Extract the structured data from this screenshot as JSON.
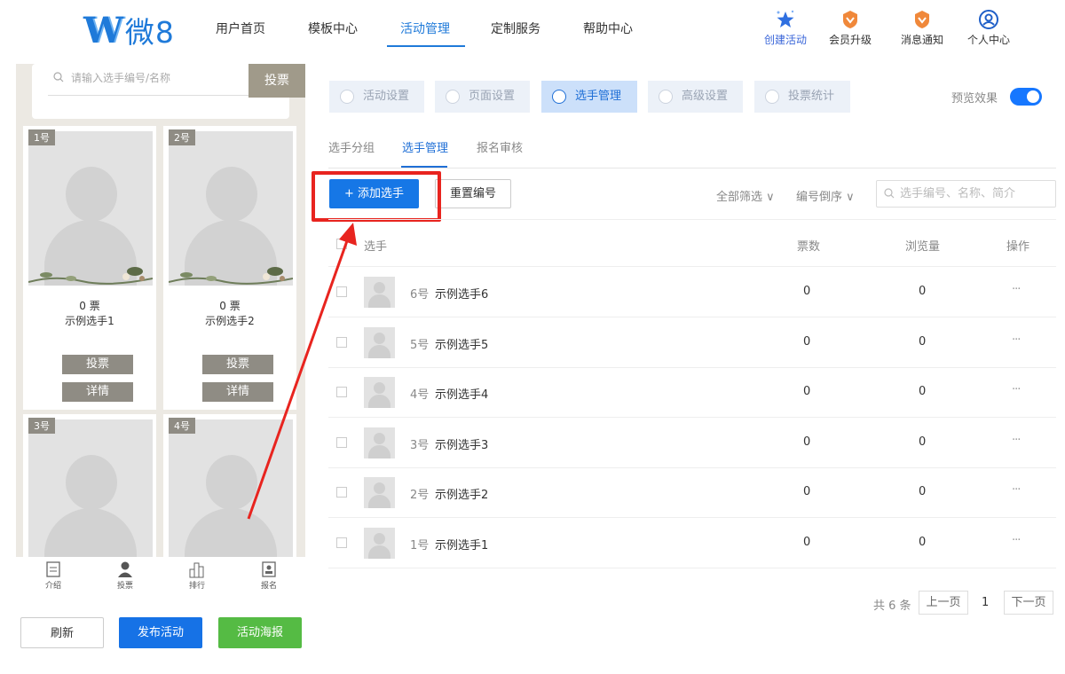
{
  "logo": {
    "mark": "W",
    "text": "微8"
  },
  "nav": [
    {
      "label": "用户首页"
    },
    {
      "label": "模板中心"
    },
    {
      "label": "活动管理"
    },
    {
      "label": "定制服务"
    },
    {
      "label": "帮助中心"
    }
  ],
  "nav_active": "活动管理",
  "tools": [
    {
      "label": "创建活动",
      "icon": "star-icon"
    },
    {
      "label": "会员升级",
      "icon": "vip-badge-icon"
    },
    {
      "label": "消息通知",
      "icon": "bell-badge-icon"
    },
    {
      "label": "个人中心",
      "icon": "user-icon"
    }
  ],
  "preview": {
    "search_placeholder": "请输入选手编号/名称",
    "search_button": "投票",
    "cards": [
      {
        "number": "1号",
        "votes": "0 票",
        "name": "示例选手1",
        "vote_label": "投票",
        "detail_label": "详情"
      },
      {
        "number": "2号",
        "votes": "0 票",
        "name": "示例选手2",
        "vote_label": "投票",
        "detail_label": "详情"
      },
      {
        "number": "3号"
      },
      {
        "number": "4号"
      }
    ],
    "tabs": [
      {
        "label": "介绍",
        "icon": "intro-icon"
      },
      {
        "label": "投票",
        "icon": "person-icon"
      },
      {
        "label": "排行",
        "icon": "ranking-icon"
      },
      {
        "label": "报名",
        "icon": "signup-icon"
      }
    ]
  },
  "left_buttons": {
    "refresh": "刷新",
    "publish": "发布活动",
    "poster": "活动海报"
  },
  "steps": [
    {
      "label": "活动设置",
      "icon": "heart-icon"
    },
    {
      "label": "页面设置",
      "icon": "page-icon"
    },
    {
      "label": "选手管理",
      "icon": "player-icon"
    },
    {
      "label": "高级设置",
      "icon": "advanced-icon"
    },
    {
      "label": "投票统计",
      "icon": "stats-icon"
    }
  ],
  "preview_toggle": {
    "label": "预览效果",
    "on": true
  },
  "subtabs": [
    {
      "label": "选手分组"
    },
    {
      "label": "选手管理"
    },
    {
      "label": "报名审核"
    }
  ],
  "toolbar": {
    "add_label": "+ 添加选手",
    "reset_label": "重置编号",
    "filter_all": "全部筛选 ∨",
    "sort_label": "编号倒序 ∨",
    "search_placeholder": "选手编号、名称、简介"
  },
  "table": {
    "headers": {
      "player": "选手",
      "votes": "票数",
      "views": "浏览量",
      "actions": "操作"
    },
    "rows": [
      {
        "number": "6号",
        "name": "示例选手6",
        "votes": "0",
        "views": "0",
        "more": "···"
      },
      {
        "number": "5号",
        "name": "示例选手5",
        "votes": "0",
        "views": "0",
        "more": "···"
      },
      {
        "number": "4号",
        "name": "示例选手4",
        "votes": "0",
        "views": "0",
        "more": "···"
      },
      {
        "number": "3号",
        "name": "示例选手3",
        "votes": "0",
        "views": "0",
        "more": "···"
      },
      {
        "number": "2号",
        "name": "示例选手2",
        "votes": "0",
        "views": "0",
        "more": "···"
      },
      {
        "number": "1号",
        "name": "示例选手1",
        "votes": "0",
        "views": "0",
        "more": "···"
      }
    ]
  },
  "pager": {
    "total": "共 6 条",
    "prev": "上一页",
    "current": "1",
    "next": "下一页"
  },
  "colors": {
    "accent": "#1677e6",
    "highlight": "#e8241f",
    "green": "#55bb44",
    "card_button": "#8f8c84"
  }
}
